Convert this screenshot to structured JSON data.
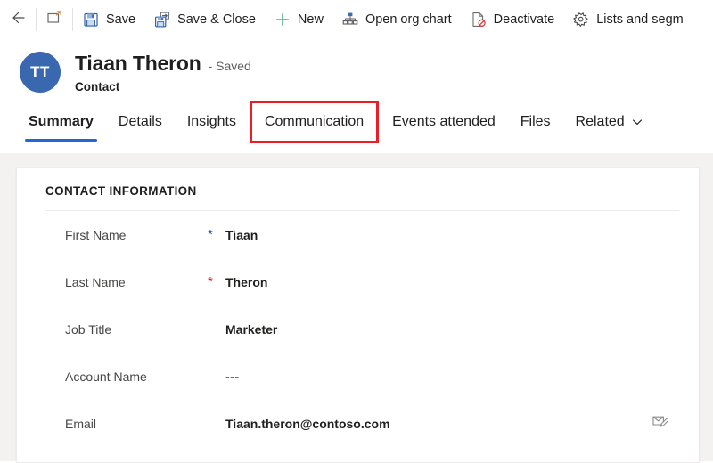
{
  "commandbar": {
    "back_icon": "back-arrow-icon",
    "popout_icon": "open-in-new-window-icon",
    "buttons": [
      {
        "label": "Save",
        "icon": "save-icon"
      },
      {
        "label": "Save & Close",
        "icon": "save-and-close-icon"
      },
      {
        "label": "New",
        "icon": "plus-icon"
      },
      {
        "label": "Open org chart",
        "icon": "org-chart-icon"
      },
      {
        "label": "Deactivate",
        "icon": "deactivate-icon"
      },
      {
        "label": "Lists and segm",
        "icon": "lists-and-segments-icon"
      }
    ]
  },
  "record_header": {
    "avatar_initials": "TT",
    "avatar_color": "#3a68b0",
    "title": "Tiaan Theron",
    "status": "- Saved",
    "entity": "Contact"
  },
  "tabs": {
    "items": [
      {
        "label": "Summary",
        "active": true,
        "boxed": false,
        "chevron": false
      },
      {
        "label": "Details",
        "active": false,
        "boxed": false,
        "chevron": false
      },
      {
        "label": "Insights",
        "active": false,
        "boxed": false,
        "chevron": false
      },
      {
        "label": "Communication",
        "active": false,
        "boxed": true,
        "chevron": false
      },
      {
        "label": "Events attended",
        "active": false,
        "boxed": false,
        "chevron": false
      },
      {
        "label": "Files",
        "active": false,
        "boxed": false,
        "chevron": false
      },
      {
        "label": "Related",
        "active": false,
        "boxed": false,
        "chevron": true
      }
    ],
    "highlight_color": "#ee1c25",
    "active_underline_color": "#2266dd"
  },
  "card": {
    "section_title": "CONTACT INFORMATION",
    "fields": [
      {
        "label": "First Name",
        "required": "recommended",
        "value": "Tiaan",
        "action_icon": null
      },
      {
        "label": "Last Name",
        "required": "required",
        "value": "Theron",
        "action_icon": null
      },
      {
        "label": "Job Title",
        "required": "none",
        "value": "Marketer",
        "action_icon": null
      },
      {
        "label": "Account Name",
        "required": "none",
        "value": "---",
        "action_icon": null
      },
      {
        "label": "Email",
        "required": "none",
        "value": "Tiaan.theron@contoso.com",
        "action_icon": "compose-email-icon"
      }
    ]
  }
}
